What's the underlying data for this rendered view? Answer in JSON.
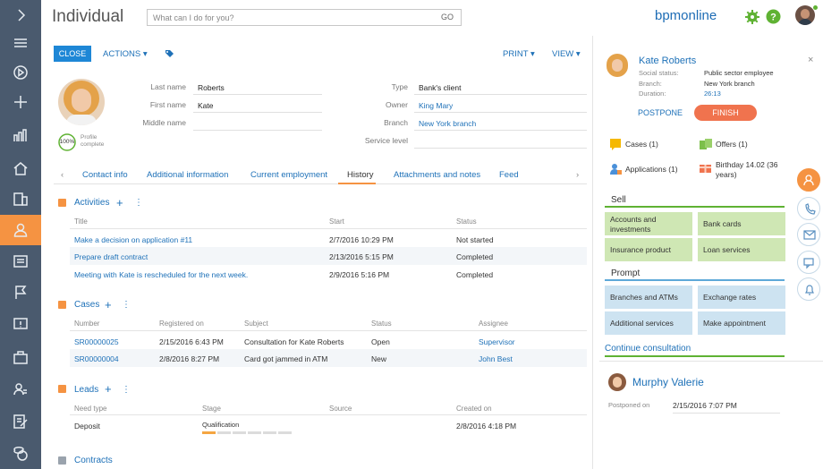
{
  "app": {
    "title": "Individual",
    "brand": "bpmonline"
  },
  "search": {
    "placeholder": "What can I do for you?",
    "go": "GO"
  },
  "toolbar": {
    "close": "CLOSE",
    "actions": "ACTIONS ▾",
    "print": "PRINT ▾",
    "view": "VIEW ▾"
  },
  "profile": {
    "complete_pct": "100%",
    "complete_label_1": "Profile",
    "complete_label_2": "complete"
  },
  "fields": {
    "last_name_label": "Last name",
    "last_name": "Roberts",
    "first_name_label": "First name",
    "first_name": "Kate",
    "middle_name_label": "Middle name",
    "middle_name": "",
    "type_label": "Type",
    "type": "Bank's client",
    "owner_label": "Owner",
    "owner": "King Mary",
    "branch_label": "Branch",
    "branch": "New York branch",
    "service_level_label": "Service level",
    "service_level": ""
  },
  "tabs": [
    "Contact info",
    "Additional information",
    "Current employment",
    "History",
    "Attachments and notes",
    "Feed"
  ],
  "activities": {
    "title": "Activities",
    "headers": [
      "Title",
      "Start",
      "Status"
    ],
    "rows": [
      [
        "Make a decision on application #11",
        "2/7/2016 10:29 PM",
        "Not started"
      ],
      [
        "Prepare draft contract",
        "2/13/2016 5:15 PM",
        "Completed"
      ],
      [
        "Meeting with Kate is rescheduled for the next week.",
        "2/9/2016 5:16 PM",
        "Completed"
      ]
    ]
  },
  "cases": {
    "title": "Cases",
    "headers": [
      "Number",
      "Registered on",
      "Subject",
      "Status",
      "Assignee"
    ],
    "rows": [
      [
        "SR00000025",
        "2/15/2016 6:43 PM",
        "Consultation for Kate Roberts",
        "Open",
        "Supervisor"
      ],
      [
        "SR00000004",
        "2/8/2016 8:27 PM",
        "Card got jammed in ATM",
        "New",
        "John Best"
      ]
    ]
  },
  "leads": {
    "title": "Leads",
    "headers": [
      "Need type",
      "Stage",
      "Source",
      "Created on"
    ],
    "rows": [
      [
        "Deposit",
        "Qualification",
        "",
        "2/8/2016 4:18 PM"
      ]
    ],
    "stage_progress": 0.17
  },
  "contracts": {
    "title": "Contracts"
  },
  "right_panel": {
    "name": "Kate Roberts",
    "social_status_label": "Social status:",
    "social_status": "Public sector employee",
    "branch_label": "Branch:",
    "branch": "New York branch",
    "duration_label": "Duration:",
    "duration": "26:13",
    "postpone": "POSTPONE",
    "finish": "FINISH",
    "cases": "Cases (1)",
    "offers": "Offers (1)",
    "applications": "Applications (1)",
    "birthday": "Birthday 14.02 (36 years)",
    "sell_title": "Sell",
    "sell_tiles": [
      "Accounts and investments",
      "Bank cards",
      "Insurance product",
      "Loan services"
    ],
    "prompt_title": "Prompt",
    "prompt_tiles": [
      "Branches and ATMs",
      "Exchange rates",
      "Additional services",
      "Make appointment"
    ],
    "continue": "Continue consultation",
    "contact2": "Murphy Valerie",
    "postponed_label": "Postponed on",
    "postponed_value": "2/15/2016 7:07 PM"
  },
  "colors": {
    "sidebar": "#4a5a6e",
    "accent": "#f59342",
    "link": "#1e71b8",
    "primary": "#1e87d6"
  }
}
